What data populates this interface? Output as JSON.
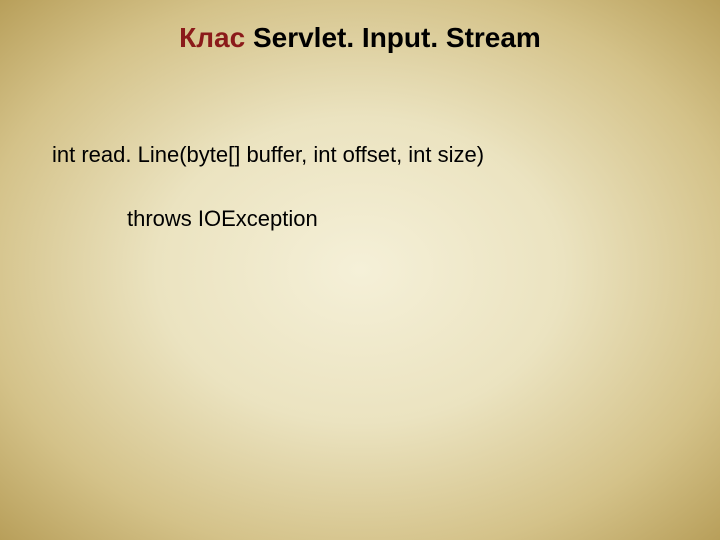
{
  "title": {
    "prefix": "Клас ",
    "main": "Servlet. Input. Stream"
  },
  "content": {
    "line1": "int read. Line(byte[] buffer, int offset, int size)",
    "line2": "throws IOException"
  }
}
